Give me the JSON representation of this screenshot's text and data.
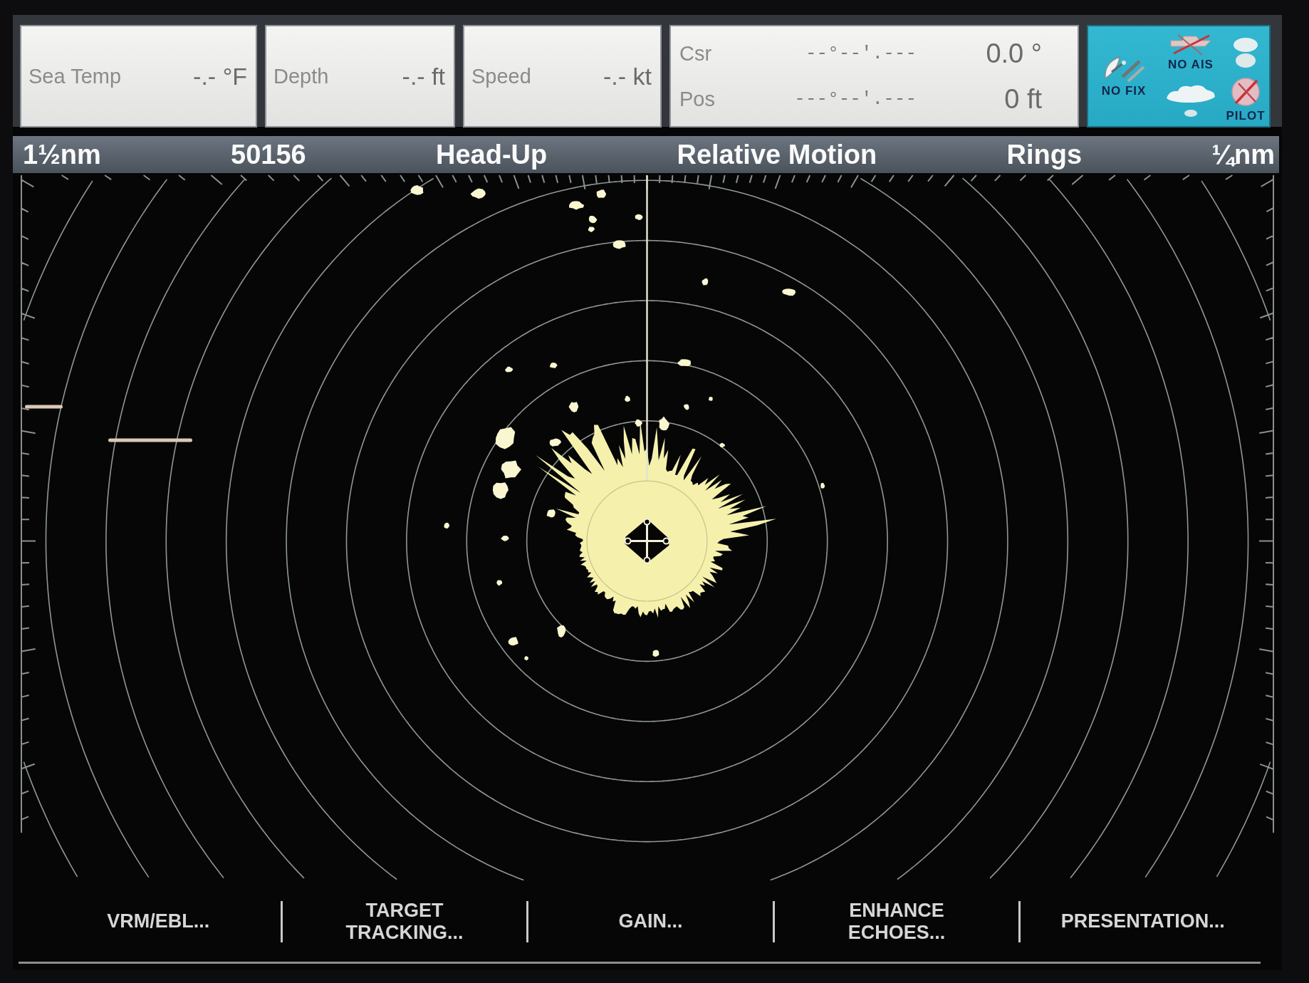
{
  "data_bar": {
    "cells": [
      {
        "kind": "single",
        "label": "Sea Temp",
        "value": "-.- °F"
      },
      {
        "kind": "single",
        "label": "Depth",
        "value": "-.- ft"
      },
      {
        "kind": "single",
        "label": "Speed",
        "value": "-.- kt"
      },
      {
        "kind": "double",
        "rows": [
          {
            "label": "Csr",
            "position": "--°--'.---",
            "value": "0.0 °"
          },
          {
            "label": "Pos",
            "position": "---°--'.---",
            "value": "0 ft"
          }
        ]
      }
    ],
    "status_panel": {
      "items": [
        {
          "kind": "gps",
          "label": "NO FIX"
        },
        {
          "kind": "ais",
          "label": "NO AIS"
        },
        {
          "kind": "stack"
        },
        {
          "kind": "boat"
        },
        {
          "kind": "pilot",
          "label": "PILOT"
        }
      ]
    }
  },
  "status_bar": {
    "items": [
      "1½nm",
      "50156",
      "Head-Up",
      "Relative Motion",
      "Rings",
      "¼nm"
    ]
  },
  "soft_keys": [
    "VRM/EBL...",
    "TARGET\nTRACKING...",
    "GAIN...",
    "ENHANCE\nECHOES...",
    "PRESENTATION..."
  ]
}
